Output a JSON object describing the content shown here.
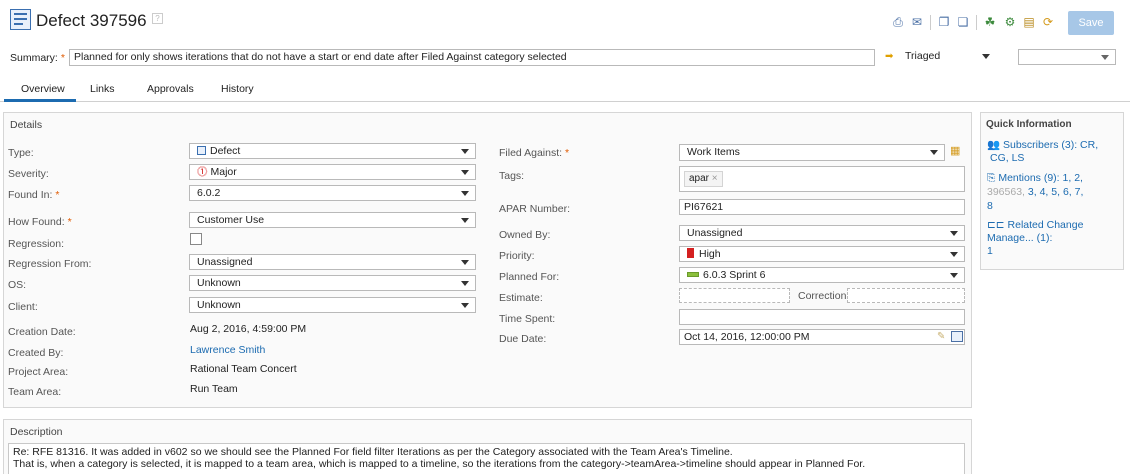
{
  "header": {
    "title": "Defect 397596",
    "help_icon": "help-icon",
    "save_label": "Save"
  },
  "summary": {
    "label": "Summary:",
    "value": "Planned for only shows iterations that do not have a start or end date after Filed Against category selected",
    "state": "Triaged",
    "resolution": ""
  },
  "tabs": [
    "Overview",
    "Links",
    "Approvals",
    "History"
  ],
  "details": {
    "heading": "Details",
    "type": {
      "label": "Type:",
      "value": "Defect"
    },
    "severity": {
      "label": "Severity:",
      "value": "Major"
    },
    "found_in": {
      "label": "Found In:",
      "value": "6.0.2"
    },
    "how_found": {
      "label": "How Found:",
      "value": "Customer Use"
    },
    "regression": {
      "label": "Regression:"
    },
    "regression_from": {
      "label": "Regression From:",
      "value": "Unassigned"
    },
    "os": {
      "label": "OS:",
      "value": "Unknown"
    },
    "client": {
      "label": "Client:",
      "value": "Unknown"
    },
    "creation_date": {
      "label": "Creation Date:",
      "value": "Aug 2, 2016, 4:59:00 PM"
    },
    "created_by": {
      "label": "Created By:",
      "value": "Lawrence Smith"
    },
    "project_area": {
      "label": "Project Area:",
      "value": "Rational Team Concert"
    },
    "team_area": {
      "label": "Team Area:",
      "value": "Run Team"
    },
    "filed_against": {
      "label": "Filed Against:",
      "value": "Work Items"
    },
    "tags": {
      "label": "Tags:",
      "value": "apar"
    },
    "apar_number": {
      "label": "APAR Number:",
      "value": "PI67621"
    },
    "owned_by": {
      "label": "Owned By:",
      "value": "Unassigned"
    },
    "priority": {
      "label": "Priority:",
      "value": "High"
    },
    "planned_for": {
      "label": "Planned For:",
      "value": "6.0.3 Sprint 6"
    },
    "estimate": {
      "label": "Estimate:",
      "correction_label": "Correction:"
    },
    "time_spent": {
      "label": "Time Spent:"
    },
    "due_date": {
      "label": "Due Date:",
      "value": "Oct 14, 2016, 12:00:00 PM"
    }
  },
  "quick_info": {
    "heading": "Quick Information",
    "subscribers": {
      "label": "Subscribers (3):",
      "items": [
        "CR,",
        "CG,",
        "LS"
      ]
    },
    "mentions": {
      "label": "Mentions (9):",
      "items": [
        "1,",
        "2,",
        "396563,",
        "3,",
        "4,",
        "5,",
        "6,",
        "7,",
        "8"
      ]
    },
    "related": {
      "label": "Related Change Manage... (1):",
      "items": [
        "1"
      ]
    }
  },
  "description": {
    "heading": "Description",
    "line1": "Re: RFE 81316. It was added in v602 so we should see the Planned For field filter Iterations as per the Category associated with the Team Area's Timeline.",
    "line2": "That is, when a category is selected, it is mapped to a team area, which is mapped to a timeline, so the iterations from the category->teamArea->timeline should appear in Planned For."
  },
  "colors": {
    "accent": "#1c6bb0",
    "save_bg": "#a7c7e7",
    "required": "#e05a00",
    "tab_active": "#1c6bb0"
  }
}
